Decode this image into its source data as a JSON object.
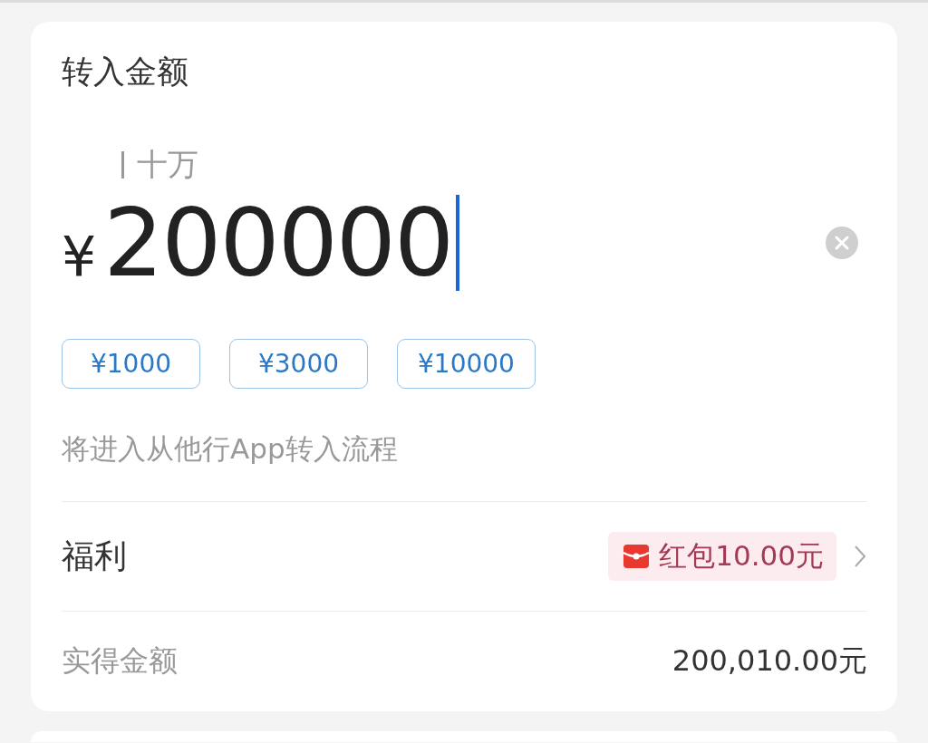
{
  "section_title": "转入金额",
  "amount": {
    "unit_hint": "十万",
    "currency": "¥",
    "value": "200000",
    "focused": true
  },
  "quick_amounts": [
    {
      "label": "¥1000"
    },
    {
      "label": "¥3000"
    },
    {
      "label": "¥10000"
    }
  ],
  "note": "将进入从他行App转入流程",
  "welfare": {
    "label": "福利",
    "badge": "红包10.00元"
  },
  "actual": {
    "label": "实得金额",
    "value": "200,010.00元"
  }
}
